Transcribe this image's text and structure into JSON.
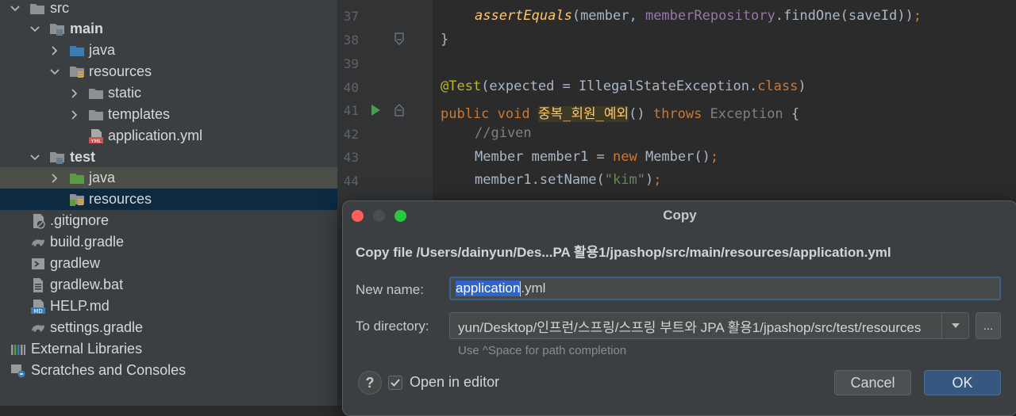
{
  "project_tree": {
    "items": [
      {
        "label": "src"
      },
      {
        "label": "main"
      },
      {
        "label": "java"
      },
      {
        "label": "resources"
      },
      {
        "label": "static"
      },
      {
        "label": "templates"
      },
      {
        "label": "application.yml",
        "icon_text": "YML"
      },
      {
        "label": "test"
      },
      {
        "label": "java"
      },
      {
        "label": "resources"
      },
      {
        "label": ".gitignore"
      },
      {
        "label": "build.gradle"
      },
      {
        "label": "gradlew"
      },
      {
        "label": "gradlew.bat"
      },
      {
        "label": "HELP.md",
        "icon_text": "MD"
      },
      {
        "label": "settings.gradle"
      },
      {
        "label": "External Libraries"
      },
      {
        "label": "Scratches and Consoles"
      }
    ]
  },
  "editor": {
    "line_numbers": [
      "37",
      "38",
      "39",
      "40",
      "41",
      "42",
      "43",
      "44"
    ],
    "tokens": {
      "l37_method": "assertEquals",
      "l37_a": "(member, ",
      "l37_field": "memberRepository",
      "l37_b": ".findOne(saveId))",
      "l37_semi": ";",
      "l38": "}",
      "l40_ann": "@Test",
      "l40_a": "(expected = IllegalStateException.",
      "l40_kw": "class",
      "l40_b": ")",
      "l41_kw1": "public void ",
      "l41_name1": "중복",
      "l41_us1": "_",
      "l41_name2": "회원",
      "l41_us2": "_",
      "l41_name3": "예외",
      "l41_a": "() ",
      "l41_throws": "throws ",
      "l41_exc": "Exception",
      "l41_b": " {",
      "l42": "//given",
      "l43_a": "Member member1 = ",
      "l43_new": "new ",
      "l43_b": "Member()",
      "l43_semi": ";",
      "l44_a": "member1.setName(",
      "l44_str": "\"kim\"",
      "l44_b": ")",
      "l44_semi": ";"
    }
  },
  "dialog": {
    "title": "Copy",
    "header": "Copy file /Users/dainyun/Des...PA 활용1/jpashop/src/main/resources/application.yml",
    "new_name_label": "New name:",
    "new_name_selected": "application",
    "new_name_rest": ".yml",
    "to_directory_label": "To directory:",
    "to_directory_value": "yun/Desktop/인프런/스프링/스프링 부트와 JPA 활용1/jpashop/src/test/resources",
    "browse_label": "...",
    "hint": "Use ^Space for path completion",
    "help_label": "?",
    "open_in_editor_label": "Open in editor",
    "open_in_editor_checked": true,
    "cancel_label": "Cancel",
    "ok_label": "OK"
  },
  "colors": {
    "tree_bg": "#3c3f41",
    "editor_bg": "#2b2b2b",
    "selection": "#0d2a40",
    "accent_button": "#365880",
    "keyword": "#cc7832",
    "method": "#ffc66d",
    "annotation": "#bbb529"
  }
}
